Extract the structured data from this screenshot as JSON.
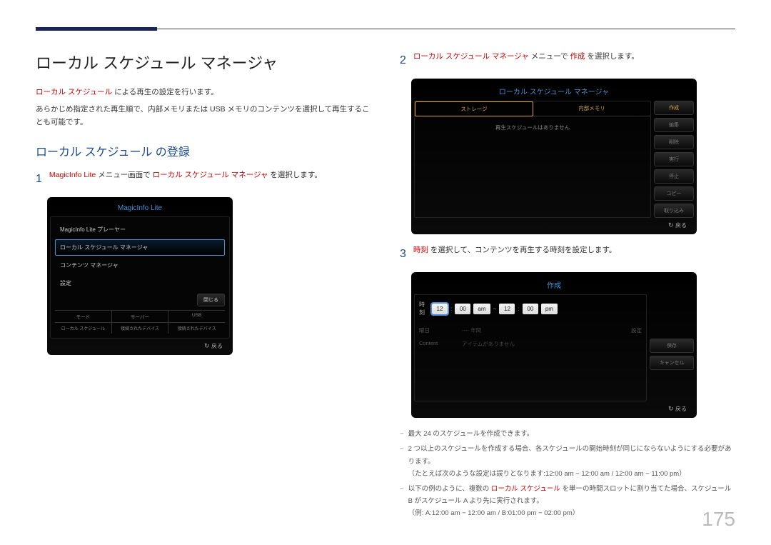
{
  "page": {
    "title": "ローカル スケジュール マネージャ",
    "intro_red": "ローカル スケジュール",
    "intro_rest": " による再生の設定を行います。",
    "intro2": "あらかじめ指定された再生順で、内部メモリまたは USB メモリのコンテンツを選択して再生することも可能です。",
    "section": "ローカル スケジュール の登録",
    "number": "175"
  },
  "step1": {
    "num": "1",
    "pre": "MagicInfo Lite",
    "mid": " メニュー画面で ",
    "red2": "ローカル スケジュール マネージャ",
    "post": " を選択します。"
  },
  "step2": {
    "num": "2",
    "red": "ローカル スケジュール マネージャ",
    "mid": " メニューで ",
    "red2": "作成",
    "post": " を選択します。"
  },
  "step3": {
    "num": "3",
    "red": "時刻",
    "post": " を選択して、コンテンツを再生する時刻を設定します。"
  },
  "dev1": {
    "title": "MagicInfo Lite",
    "items": [
      "MagicInfo Lite プレーヤー",
      "ローカル スケジュール マネージャ",
      "コンテンツ マネージャ",
      "設定"
    ],
    "close": "閉じる",
    "status_h": [
      "モード",
      "サーバー",
      "USB"
    ],
    "status_v": [
      "ローカル スケジュール",
      "接続されたデバイス",
      "接続されたデバイス"
    ],
    "return": "戻る"
  },
  "dev2": {
    "title": "ローカル スケジュール マネージャ",
    "tabs": [
      "ストレージ",
      "内部メモリ"
    ],
    "msg": "再生スケジュールはありません",
    "buttons": [
      "作成",
      "編集",
      "削除",
      "実行",
      "停止",
      "コピー",
      "取り込み"
    ],
    "return": "戻る"
  },
  "dev3": {
    "title": "作成",
    "time_label": "時刻",
    "t": {
      "h1": "12",
      "m1": "00",
      "ap1": "am",
      "dash": "~",
      "h2": "12",
      "m2": "00",
      "ap2": "pm",
      "colon": ":"
    },
    "row_date_l": "曜日",
    "row_date_v": "---- 年間",
    "row_date_d": "設定",
    "row_cont_l": "Content",
    "row_cont_v": "アイテムがありません",
    "btn_save": "保存",
    "btn_cancel": "キャンセル",
    "return": "戻る"
  },
  "notes": {
    "n1": "最大 24 のスケジュールを作成できます。",
    "n2a": "2 つ以上のスケジュールを作成する場合、各スケジュールの開始時刻が同じにならないようにする必要があります。",
    "n2b": "（たとえば次のような設定は誤りとなります:12:00 am − 12:00 am / 12:00 am − 11:00 pm）",
    "n3a_pre": "以下の例のように、複数の ",
    "n3a_red": "ローカル スケジュール",
    "n3a_post": " を単一の時間スロットに割り当てた場合、スケジュール B がスケジュール A より先に実行されます。",
    "n3b": "（例: A:12:00 am − 12:00 am / B:01:00 pm − 02:00 pm）"
  }
}
